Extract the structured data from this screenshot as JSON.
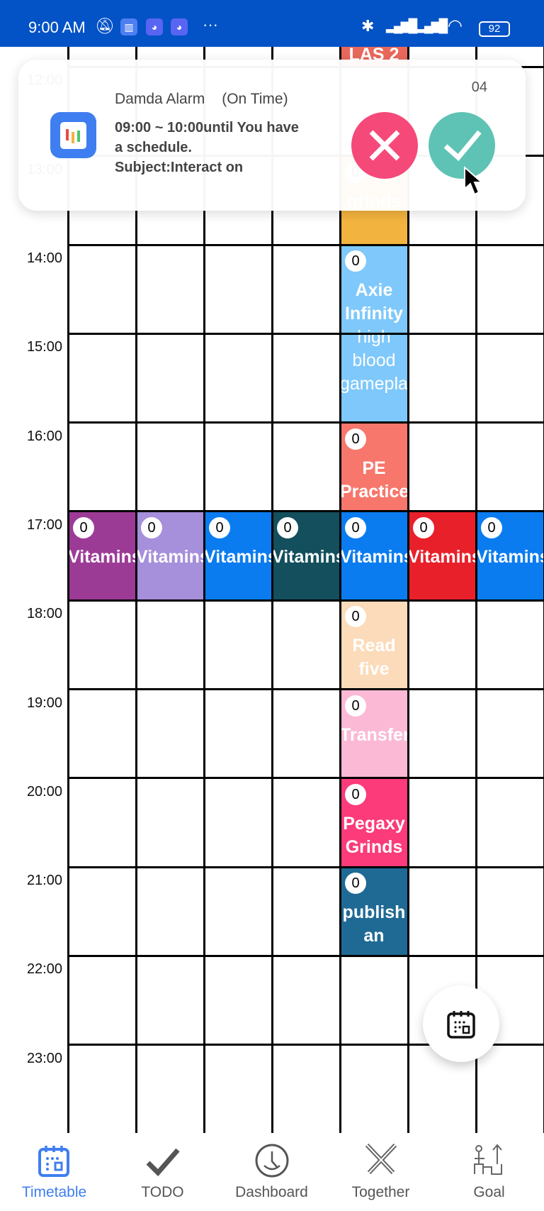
{
  "status_bar": {
    "time": "9:00 AM",
    "battery": "92"
  },
  "timetable": {
    "hours": [
      "12:00",
      "13:00",
      "14:00",
      "15:00",
      "16:00",
      "17:00",
      "18:00",
      "19:00",
      "20:00",
      "21:00",
      "22:00",
      "23:00"
    ],
    "events": [
      {
        "col": 4,
        "start": 11,
        "color": "#e9685c",
        "title": "LAS 2",
        "memo": "",
        "count": ""
      },
      {
        "col": 4,
        "start": 13,
        "color": "#f3b43f",
        "title": "grinds",
        "memo": "",
        "count": "0"
      },
      {
        "col": 4,
        "start": 14,
        "end": 16,
        "color": "#7ec8fb",
        "title": "Axie Infinity",
        "memo": "high blood gameplay",
        "count": "0"
      },
      {
        "col": 4,
        "start": 16,
        "color": "#f7776c",
        "title": "PE Practice",
        "memo": "",
        "count": "0"
      },
      {
        "col": 0,
        "start": 17,
        "color": "#9c3b96",
        "title": "Vitamins",
        "memo": "",
        "count": "0"
      },
      {
        "col": 1,
        "start": 17,
        "color": "#a68fdb",
        "title": "Vitamins",
        "memo": "",
        "count": "0"
      },
      {
        "col": 2,
        "start": 17,
        "color": "#0a7cf0",
        "title": "Vitamins",
        "memo": "",
        "count": "0"
      },
      {
        "col": 3,
        "start": 17,
        "color": "#134f5c",
        "title": "Vitamins",
        "memo": "",
        "count": "0"
      },
      {
        "col": 4,
        "start": 17,
        "color": "#0a7cf0",
        "title": "Vitamins",
        "memo": "",
        "count": "0"
      },
      {
        "col": 5,
        "start": 17,
        "color": "#e8202a",
        "title": "Vitamins",
        "memo": "",
        "count": "0"
      },
      {
        "col": 6,
        "start": 17,
        "color": "#0a7cf0",
        "title": "Vitamins",
        "memo": "",
        "count": "0"
      },
      {
        "col": 4,
        "start": 18,
        "color": "#fbdbb9",
        "title": "Read five",
        "memo": "",
        "count": "0"
      },
      {
        "col": 4,
        "start": 19,
        "color": "#fbb9d5",
        "title": "Transfer",
        "memo": "",
        "count": "0"
      },
      {
        "col": 4,
        "start": 20,
        "color": "#fb3b7a",
        "title": "Pegaxy Grinds",
        "memo": "",
        "count": "0"
      },
      {
        "col": 4,
        "start": 21,
        "color": "#1f6a94",
        "title": "publish an",
        "memo": "",
        "count": "0"
      }
    ]
  },
  "notification": {
    "app": "Damda Alarm",
    "type": "(On Time)",
    "time": "04",
    "body": "09:00 ~ 10:00until You have a schedule. Subject:Interact on",
    "dismiss_color": "#f5497a",
    "confirm_color": "#5ec3b4"
  },
  "nav": {
    "active_color": "#3f7ef0",
    "items": [
      {
        "label": "Timetable",
        "icon": "calendar-icon"
      },
      {
        "label": "TODO",
        "icon": "check-icon"
      },
      {
        "label": "Dashboard",
        "icon": "clock-face-icon"
      },
      {
        "label": "Together",
        "icon": "crossed-swords-icon"
      },
      {
        "label": "Goal",
        "icon": "stairs-goal-icon"
      }
    ]
  }
}
